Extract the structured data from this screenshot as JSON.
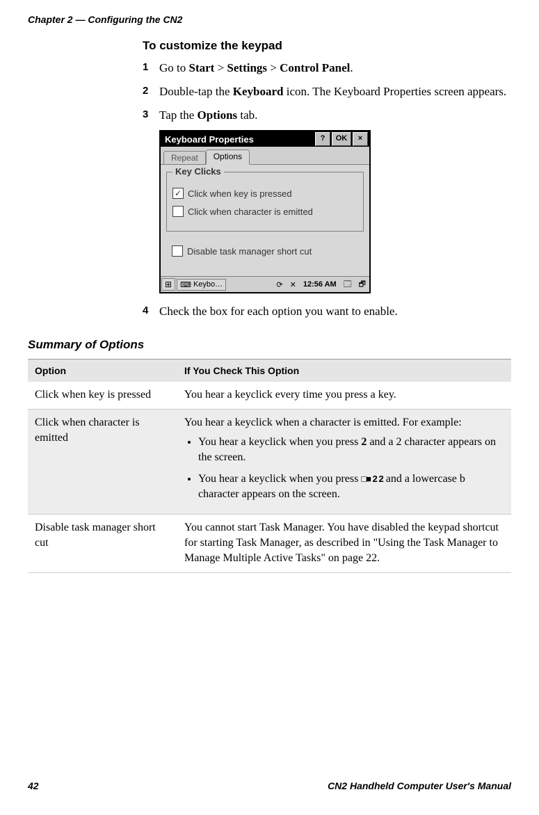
{
  "chapterHeader": "Chapter 2 — Configuring the CN2",
  "heading": "To customize the keypad",
  "steps": {
    "s1_pre": "Go to ",
    "s1_b1": "Start",
    "s1_gt1": " > ",
    "s1_b2": "Settings",
    "s1_gt2": " > ",
    "s1_b3": "Control Panel",
    "s1_post": ".",
    "s2_pre": "Double-tap the ",
    "s2_b1": "Keyboard",
    "s2_post": " icon. The Keyboard Properties screen appears.",
    "s3_pre": "Tap the ",
    "s3_b1": "Options",
    "s3_post": " tab.",
    "s4": "Check the box for each option you want to enable."
  },
  "win": {
    "title": "Keyboard Properties",
    "helpBtn": "?",
    "okBtn": "OK",
    "closeBtn": "×",
    "tabRepeat": "Repeat",
    "tabOptions": "Options",
    "groupLabel": "Key Clicks",
    "chk1": "Click when key is pressed",
    "chk2": "Click when character is emitted",
    "chk3": "Disable task manager short cut",
    "taskApp": "Keybo…",
    "taskTime": "12:56 AM"
  },
  "summaryHeading": "Summary of Options",
  "tableHead": {
    "col1": "Option",
    "col2": "If You Check This Option"
  },
  "rows": {
    "r1_opt": "Click when key is pressed",
    "r1_desc": "You hear a keyclick every time you press a key.",
    "r2_opt": "Click when character is emitted",
    "r2_desc_a": "You hear a keyclick when a character is emitted. For example:",
    "r2_b1_pre": "You hear a keyclick when you press ",
    "r2_b1_key": "2",
    "r2_b1_post": " and a 2 character appears on the screen.",
    "r2_b2_pre": "You hear a keyclick when you press ",
    "r2_b2_key": "□■ 2 2",
    "r2_b2_post": " and a lowercase b character appears on the screen.",
    "r3_opt": "Disable task manager short cut",
    "r3_desc": "You cannot start Task Manager. You have disabled the keypad shortcut for starting Task Manager, as described in \"Using the Task Manager to Manage Multiple Active Tasks\" on page 22."
  },
  "footer": {
    "pageNum": "42",
    "manual": "CN2 Handheld Computer User's Manual"
  }
}
